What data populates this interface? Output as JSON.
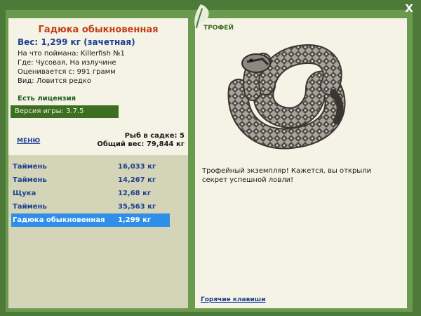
{
  "window": {
    "close_label": "X"
  },
  "catch": {
    "title": "Гадюка обыкновенная",
    "weight": "Вес: 1,299 кг (зачетная)",
    "bait": "На что поймана: Killerfish №1",
    "place": "Где: Чусовая, На излучине",
    "value": "Оценивается с: 991 грамм",
    "kind": "Вид: Ловится редко"
  },
  "license": "Есть лицензия",
  "version": "Версия игры: 3.7.5",
  "menu_label": "МЕНЮ",
  "net": {
    "count": "Рыб в садке: 5",
    "total": "Общий вес: 79,844 кг"
  },
  "fish_list": [
    {
      "name": "Таймень",
      "weight": "16,033 кг"
    },
    {
      "name": "Таймень",
      "weight": "14,267 кг"
    },
    {
      "name": "Щука",
      "weight": "12,68 кг"
    },
    {
      "name": "Таймень",
      "weight": "35,563 кг"
    },
    {
      "name": "Гадюка обыкновенная",
      "weight": "1,299 кг"
    }
  ],
  "trophy": {
    "title": "ТРОФЕЙ",
    "text": "Трофейный экземпляр! Кажется, вы открыли секрет успешной ловли!"
  },
  "hotkeys_label": "Горячие клавиши",
  "colors": {
    "frame": "#4d7a38",
    "panel": "#f4f3e6",
    "selected_row": "#2f8ee8",
    "catch_title": "#c43a14",
    "link": "#1f3f8f"
  },
  "icons": {
    "logo": "leaf-logo-icon",
    "trophy_image": "viper-snake-image"
  }
}
